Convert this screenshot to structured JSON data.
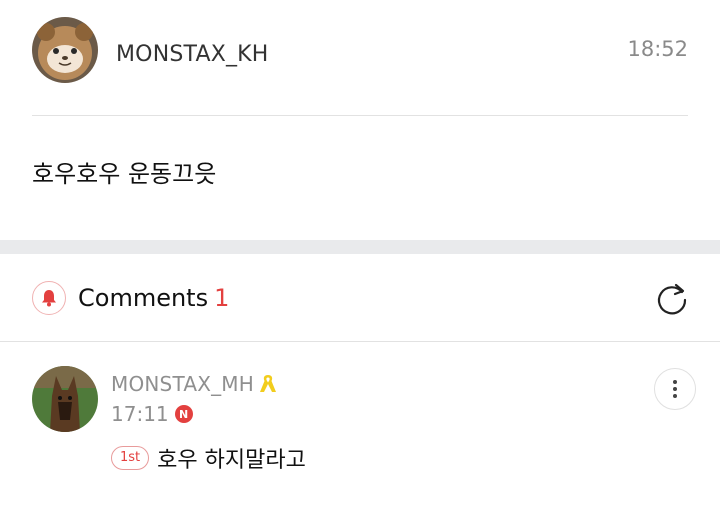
{
  "post": {
    "author": "MONSTAX_KH",
    "time": "18:52",
    "body": "호우호우 운동끄읏"
  },
  "comments_section": {
    "title": "Comments",
    "count": "1"
  },
  "comment": {
    "author": "MONSTAX_MH",
    "time": "17:11",
    "new_badge": "N",
    "rank_badge": "1st",
    "text": "호우 하지말라고"
  },
  "colors": {
    "accent": "#e3403f",
    "section_gap": "#e9eaec",
    "ribbon": "#f2cd1d"
  },
  "icons": [
    "bell-icon",
    "refresh-icon",
    "more-vertical-icon",
    "yellow-ribbon-icon"
  ]
}
